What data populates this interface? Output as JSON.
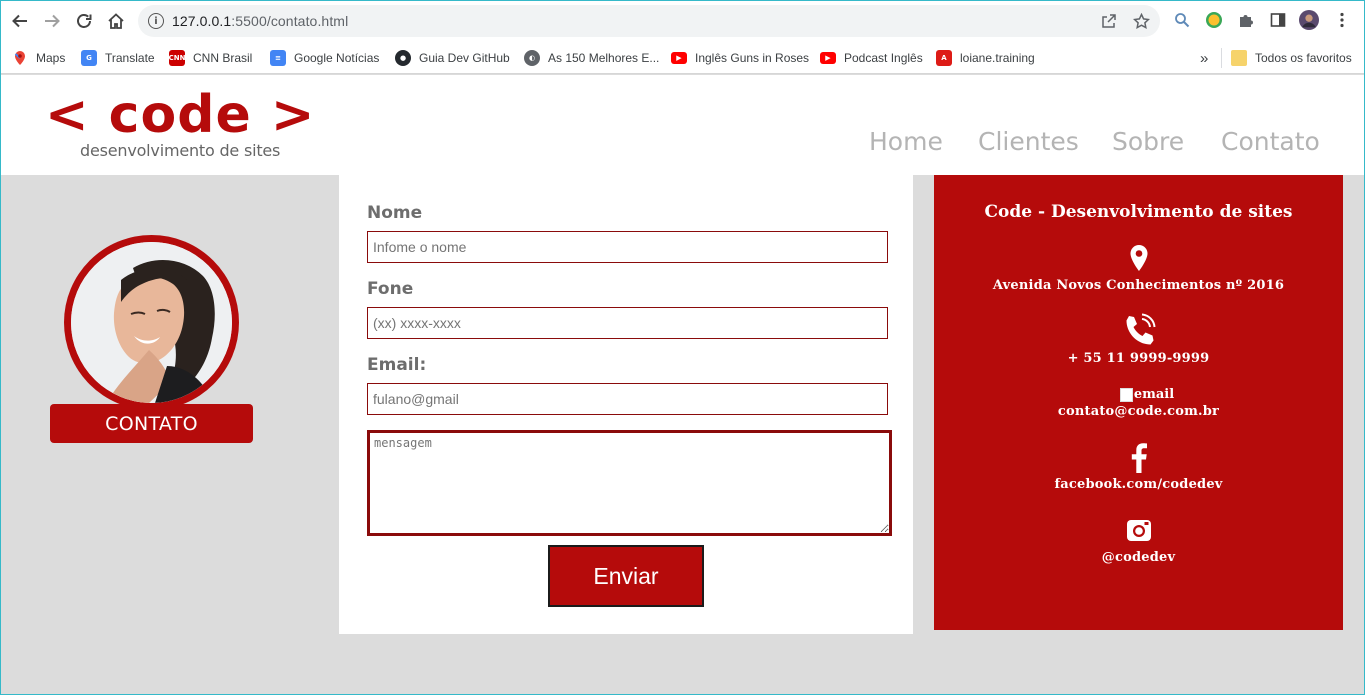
{
  "browser": {
    "url_host": "127.0.0.1",
    "url_rest": ":5500/contato.html",
    "bookmarks": [
      {
        "label": "Maps",
        "icon": "maps-icon"
      },
      {
        "label": "Translate",
        "icon": "translate-icon"
      },
      {
        "label": "CNN Brasil",
        "icon": "cnn-icon"
      },
      {
        "label": "Google Notícias",
        "icon": "google-news-icon"
      },
      {
        "label": "Guia Dev GitHub",
        "icon": "github-icon"
      },
      {
        "label": "As 150 Melhores E...",
        "icon": "globe-icon"
      },
      {
        "label": "Inglês Guns in Roses",
        "icon": "youtube-icon"
      },
      {
        "label": "Podcast Inglês",
        "icon": "youtube-icon"
      },
      {
        "label": "loiane.training",
        "icon": "angular-icon"
      }
    ],
    "more_bookmarks": "»",
    "all_favorites": "Todos os favoritos"
  },
  "site": {
    "logo": "< code >",
    "tagline": "desenvolvimento de sites",
    "menu": [
      "Home",
      "Clientes",
      "Sobre",
      "Contato"
    ]
  },
  "sidebar": {
    "contact_button": "CONTATO"
  },
  "form": {
    "name_label": "Nome",
    "name_placeholder": "Infome o nome",
    "phone_label": "Fone",
    "phone_placeholder": "(xx) xxxx-xxxx",
    "email_label": "Email:",
    "email_placeholder": "fulano@gmail",
    "message_placeholder": "mensagem",
    "submit_label": "Enviar"
  },
  "info": {
    "title": "Code - Desenvolvimento de sites",
    "address": "Avenida Novos Conhecimentos nº 2016",
    "phone": "+ 55 11 9999-9999",
    "email_alt": "email",
    "email": "contato@code.com.br",
    "facebook": "facebook.com/codedev",
    "instagram": "@codedev"
  },
  "colors": {
    "brand": "#b50b0b",
    "menu_text": "#b4b4b4",
    "page_bg": "#dcdcdc"
  }
}
